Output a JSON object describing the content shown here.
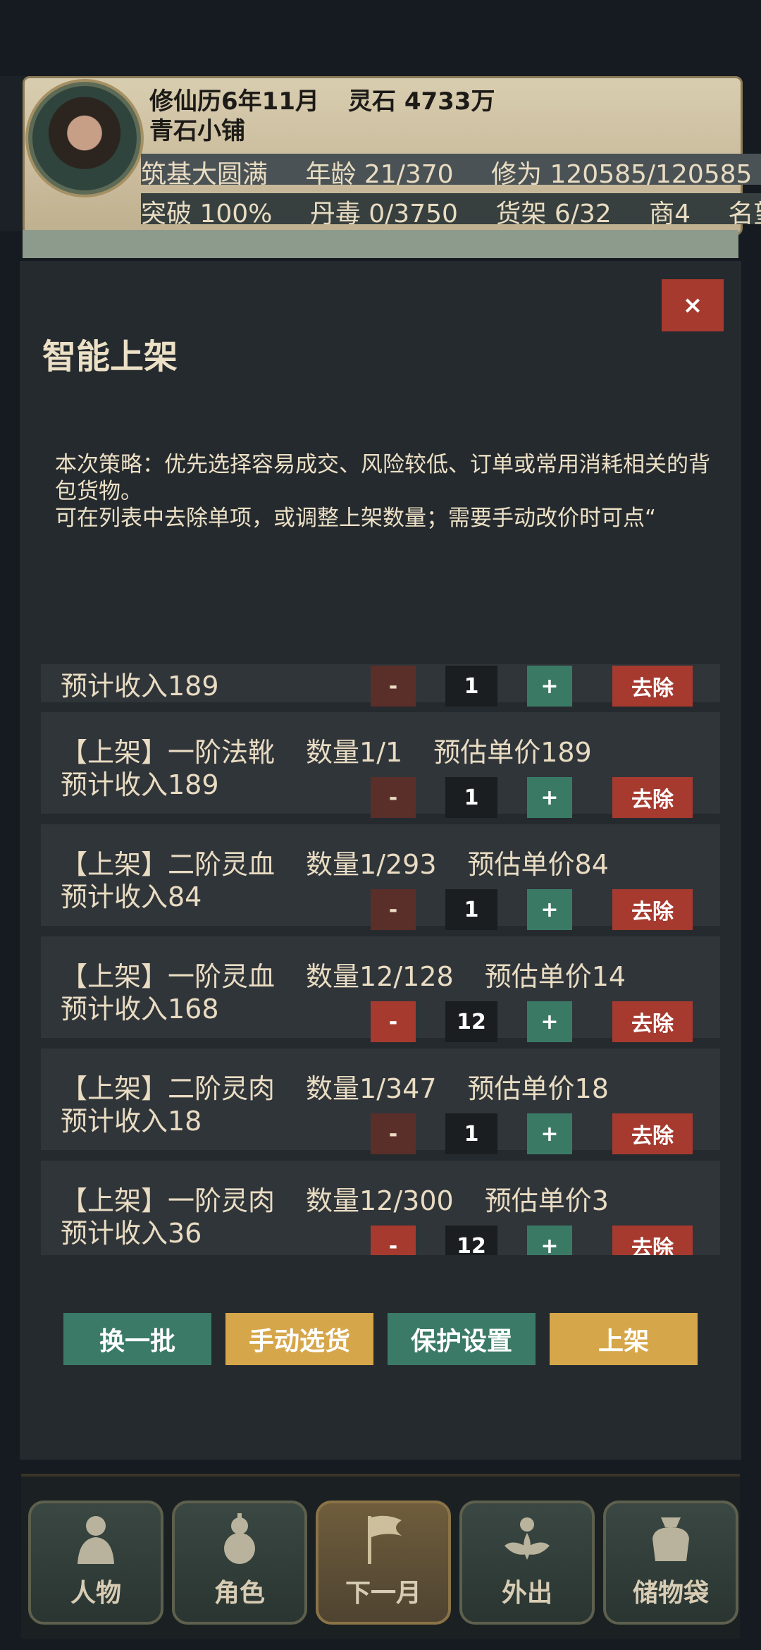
{
  "header": {
    "date": "修仙历6年11月",
    "spirit_stone": "灵石 4733万",
    "shop_name": "青石小铺",
    "stats_row1": [
      "筑基大圆满",
      "年龄 21/370",
      "修为 120585/120585"
    ],
    "stats_row2": [
      "突破 100%",
      "丹毒 0/3750",
      "货架 6/32",
      "商4",
      "名望"
    ]
  },
  "modal": {
    "title": "智能上架",
    "close_label": "×",
    "strategy_lines": [
      "本次策略：优先选择容易成交、风险较低、订单或常用消耗相关的背包货物。",
      "可在列表中去除单项，或调整上架数量；需要手动改价时可点“"
    ]
  },
  "controls": {
    "minus": "-",
    "plus": "+",
    "remove": "去除"
  },
  "items": [
    {
      "name": "",
      "count": "",
      "unit_price": "",
      "income": "预计收入189",
      "qty": "1",
      "minus_enabled": false
    },
    {
      "name": "【上架】一阶法靴",
      "count": "数量1/1",
      "unit_price": "预估单价189",
      "income": "预计收入189",
      "qty": "1",
      "minus_enabled": false
    },
    {
      "name": "【上架】二阶灵血",
      "count": "数量1/293",
      "unit_price": "预估单价84",
      "income": "预计收入84",
      "qty": "1",
      "minus_enabled": false
    },
    {
      "name": "【上架】一阶灵血",
      "count": "数量12/128",
      "unit_price": "预估单价14",
      "income": "预计收入168",
      "qty": "12",
      "minus_enabled": true
    },
    {
      "name": "【上架】二阶灵肉",
      "count": "数量1/347",
      "unit_price": "预估单价18",
      "income": "预计收入18",
      "qty": "1",
      "minus_enabled": false
    },
    {
      "name": "【上架】一阶灵肉",
      "count": "数量12/300",
      "unit_price": "预估单价3",
      "income": "预计收入36",
      "qty": "12",
      "minus_enabled": true
    }
  ],
  "actions": {
    "refresh": "换一批",
    "manual": "手动选货",
    "protect": "保护设置",
    "list": "上架"
  },
  "colors": {
    "green": "#3b7a66",
    "gold": "#d6a64a",
    "red": "#a63a2f"
  },
  "nav": [
    {
      "label": "人物",
      "icon": "person-icon"
    },
    {
      "label": "角色",
      "icon": "gourd-icon"
    },
    {
      "label": "下一月",
      "icon": "flag-icon"
    },
    {
      "label": "外出",
      "icon": "lotus-icon"
    },
    {
      "label": "储物袋",
      "icon": "bag-icon"
    }
  ]
}
